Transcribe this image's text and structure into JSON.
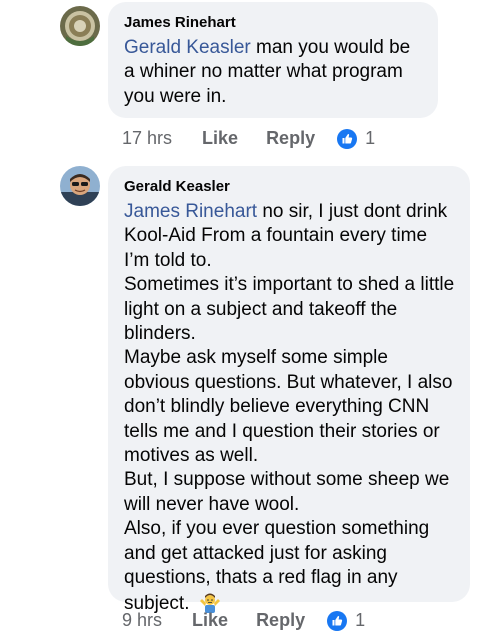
{
  "comments": [
    {
      "author": "James Rinehart",
      "mention": "Gerald Keasler",
      "text": " man you would be a whiner no matter what program you were in.",
      "time": "17 hrs",
      "like_label": "Like",
      "reply_label": "Reply",
      "reaction_icon": "like-icon",
      "reaction_count": "1"
    },
    {
      "author": "Gerald Keasler",
      "mention": "James Rinehart",
      "text": " no sir, I just dont drink Kool-Aid From a fountain every time I’m told to.\nSometimes it’s important to shed a little light on a subject and takeoff the blinders.\nMaybe ask myself some simple obvious questions. But whatever, I also don’t blindly believe everything CNN tells me and I question their stories or motives as well.\nBut, I suppose without some sheep we will never have wool.\nAlso, if you ever question something and get attacked just for asking questions, thats a red flag in any subject. ",
      "emoji": "person-shrugging-emoji",
      "time": "9 hrs",
      "like_label": "Like",
      "reply_label": "Reply",
      "reaction_icon": "like-icon",
      "reaction_count": "1"
    }
  ],
  "colors": {
    "bubble": "#f0f2f5",
    "mention": "#385898",
    "meta": "#65676b",
    "like_blue": "#1877f2"
  }
}
